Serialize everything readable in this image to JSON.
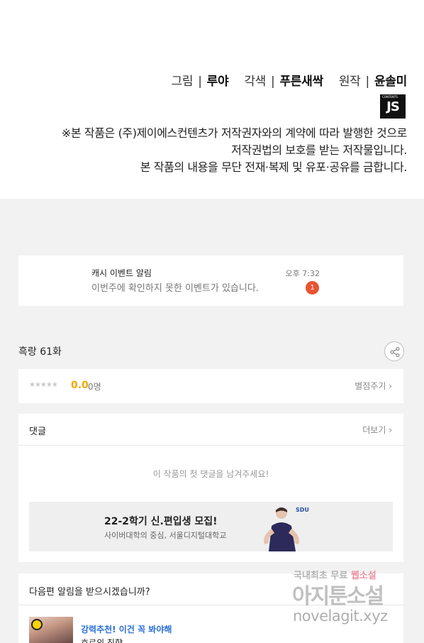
{
  "credits": {
    "art_role": "그림",
    "art_name": "루야",
    "adapt_role": "각색",
    "adapt_name": "푸른새싹",
    "original_role": "원작",
    "original_name": "윤솔미",
    "separator": "|",
    "publisher_logo": "JS",
    "notice_lines": [
      "※본 작품은 (주)제이에스컨텐츠가 저작권자와의 계약에 따라 발행한 것으로",
      "저작권법의 보호를 받는 저작물입니다.",
      "본 작품의 내용을 무단 전재·복제 및 유포·공유를 금합니다."
    ]
  },
  "alert": {
    "title": "캐시 이벤트 알림",
    "message": "이번주에 확인하지 못한 이벤트가 있습니다.",
    "time": "오후 7:32",
    "badge_count": "1"
  },
  "episode": {
    "title": "흑랑 61화",
    "share_icon": "share-icon"
  },
  "rating": {
    "stars": "★★★★★",
    "score": "0.0",
    "people": "0명",
    "rate_link": "별점주기 ›"
  },
  "comments": {
    "label": "댓글",
    "more_link": "더보기 ›",
    "empty_message": "이 작품의 첫 댓글을 남겨주세요!"
  },
  "ad": {
    "title": "22-2학기 신.편입생 모집!",
    "subtitle": "사이버대학의 중심, 서울디지털대학교",
    "logo": "SDU"
  },
  "next_episode": {
    "question": "다음편 알림을 받으시겠습니까?",
    "reco_title": "강력추천! 이건 꼭 봐야해",
    "reco_subtitle": "호로의 침향"
  },
  "watermark": {
    "line1_a": "국내최초 무료",
    "line1_b": "웹소설",
    "line2": "아지툰소설",
    "line3": "novelagit.xyz"
  },
  "colors": {
    "accent_blue": "#2a6fd6",
    "score_yellow": "#f3a600",
    "badge_red": "#e8542f",
    "background": "#f2f2f2"
  }
}
